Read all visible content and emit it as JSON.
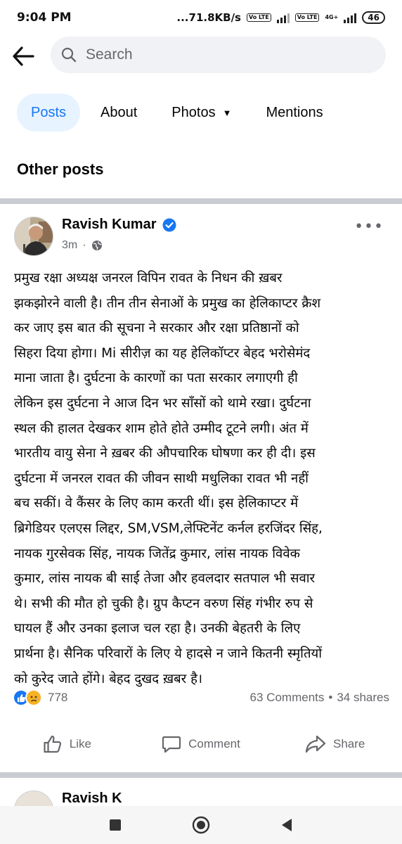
{
  "status_bar": {
    "time": "9:04 PM",
    "net_speed": "...71.8KB/s",
    "volte1": "Vo LTE",
    "volte2": "Vo LTE",
    "net_type": "4G+",
    "battery": "46"
  },
  "search": {
    "placeholder": "Search"
  },
  "tabs": [
    {
      "label": "Posts",
      "active": true
    },
    {
      "label": "About",
      "active": false
    },
    {
      "label": "Photos",
      "active": false,
      "dropdown": true
    },
    {
      "label": "Mentions",
      "active": false
    }
  ],
  "section_title": "Other posts",
  "post": {
    "author": "Ravish Kumar",
    "verified": true,
    "time": "3m",
    "separator": "·",
    "audience_icon": "globe-icon",
    "text": "प्रमुख रक्षा अध्यक्ष जनरल विपिन रावत के निधन की ख़बर\nझकझोरने वाली है। तीन तीन सेनाओं के प्रमुख का हेलिकाप्टर क्रैश\nकर जाए इस बात की सूचना ने सरकार और रक्षा प्रतिष्ठानों को\nसिहरा दिया होगा। Mi सीरीज़ का यह हेलिकॉप्टर बेहद भरोसेमंद\nमाना जाता है। दुर्घटना के कारणों का पता सरकार लगाएगी ही\nलेकिन इस दुर्घटना ने आज दिन भर साँसों को थामे रखा। दुर्घटना\nस्थल की हालत देखकर शाम होते होते उम्मीद टूटने लगी। अंत में\nभारतीय वायु सेना ने ख़बर की औपचारिक घोषणा कर ही दी। इस\nदुर्घटना में जनरल रावत की जीवन साथी मधुलिका रावत भी नहीं\nबच सकीं। वे कैंसर के लिए काम करती थीं। इस हेलिकाप्टर में\nब्रिगेडियर एलएस लिद्दर, SM,VSM,लेफ्टिनेंट कर्नल हरजिंदर सिंह,\nनायक गुरसेवक सिंह, नायक जितेंद्र कुमार, लांस नायक विवेक\nकुमार, लांस नायक बी साई तेजा और हवलदार सतपाल भी सवार\nथे। सभी की मौत हो चुकी है। ग्रुप कैप्टन वरुण सिंह गंभीर रुप से\nघायल हैं और उनका इलाज चल रहा है। उनकी बेहतरी के लिए\nप्रार्थना है। सैनिक परिवारों के लिए ये हादसे न जाने कितनी स्मृतियों\nको कुरेद जाते होंगे। बेहद दुखद ख़बर है।",
    "reactions": [
      "like",
      "sad"
    ],
    "reaction_count": "778",
    "comments": "63 Comments",
    "stat_separator": "•",
    "shares": "34 shares",
    "actions": {
      "like": "Like",
      "comment": "Comment",
      "share": "Share"
    }
  },
  "next_post": {
    "author_partial": "Ravish K"
  },
  "colors": {
    "accent": "#1877f2",
    "tab_active_bg": "#e7f3ff",
    "secondary_text": "#65676b",
    "search_bg": "#f0f2f5"
  }
}
